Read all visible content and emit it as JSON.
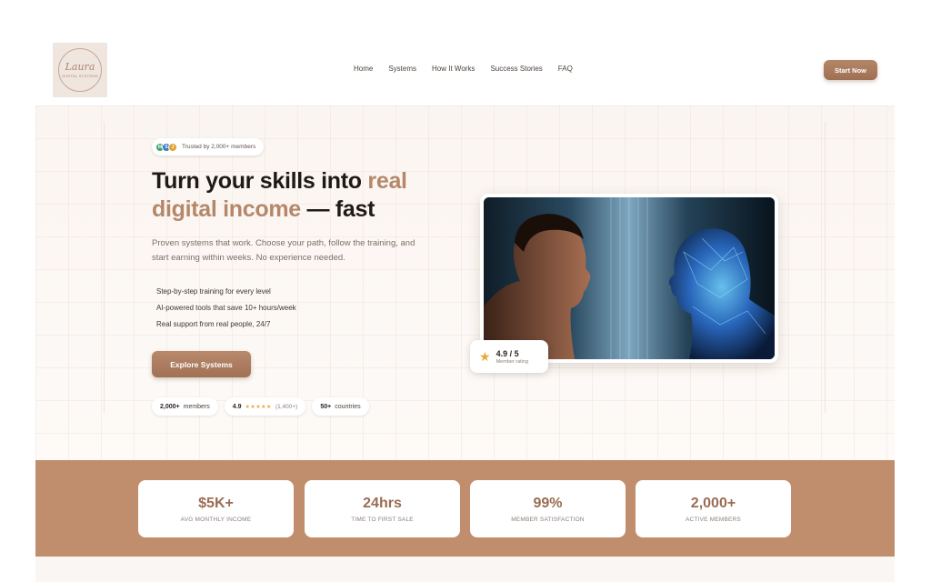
{
  "brand": {
    "logo_text": "Laura",
    "logo_sub": "DIGITAL SYSTEMS"
  },
  "nav": {
    "items": [
      "Home",
      "Systems",
      "How It Works",
      "Success Stories",
      "FAQ"
    ]
  },
  "header": {
    "cta_label": "Start Now"
  },
  "hero": {
    "trusted_text": "Trusted by 2,000+ members",
    "avatars": [
      "M",
      "S",
      "J"
    ],
    "headline_part1": "Turn your skills into ",
    "headline_accent1": "real digital income",
    "headline_part2": " — fast",
    "subtext": "Proven systems that work. Choose your path, follow the training, and start earning within weeks. No experience needed.",
    "bullets": [
      "Step-by-step training for every level",
      "AI-powered tools that save 10+ hours/week",
      "Real support from real people, 24/7"
    ],
    "cta_label": "Explore Systems",
    "pills": {
      "members_value": "2,000+",
      "members_label": "members",
      "rating_value": "4.9",
      "rating_stars": "★★★★★",
      "rating_count": "(1,400+)",
      "countries_value": "50+",
      "countries_label": "countries"
    }
  },
  "rating_card": {
    "value": "4.9 / 5",
    "label": "Member rating"
  },
  "stats": [
    {
      "value": "$5K+",
      "label": "AVG MONTHLY INCOME"
    },
    {
      "value": "24hrs",
      "label": "TIME TO FIRST SALE"
    },
    {
      "value": "99%",
      "label": "MEMBER SATISFACTION"
    },
    {
      "value": "2,000+",
      "label": "ACTIVE MEMBERS"
    }
  ],
  "colors": {
    "accent": "#b58769",
    "band": "#c08d6d",
    "star": "#e9a93a"
  }
}
